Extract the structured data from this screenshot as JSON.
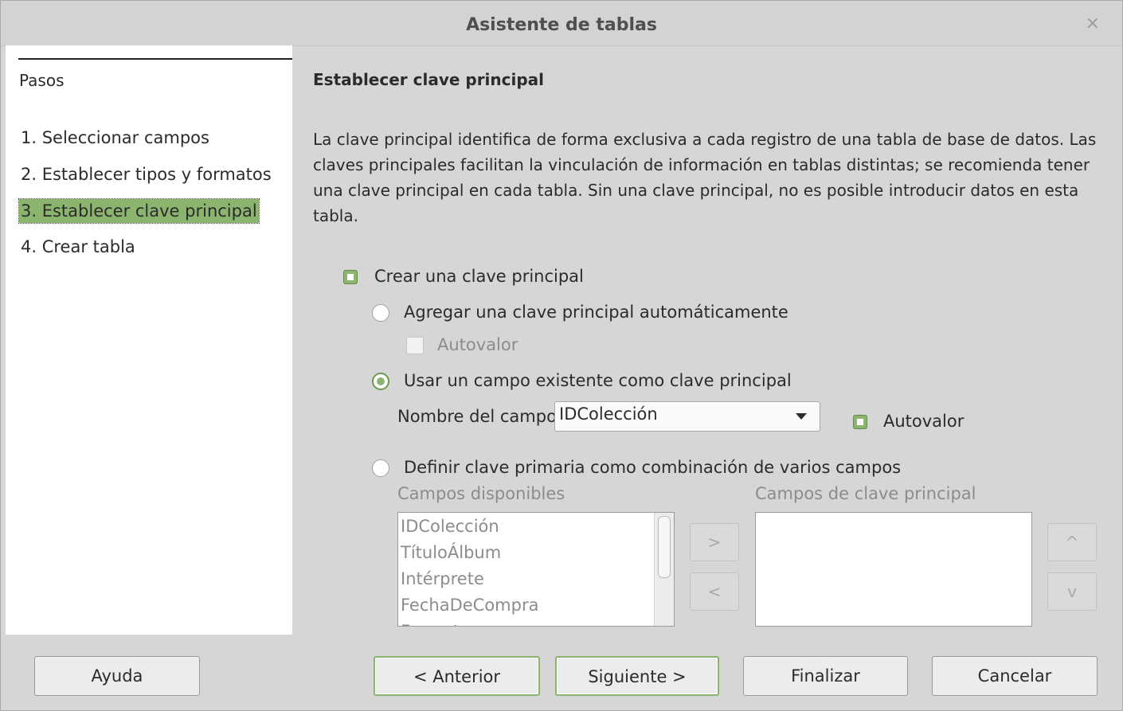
{
  "window": {
    "title": "Asistente de tablas",
    "close_label": "×"
  },
  "sidebar": {
    "heading": "Pasos",
    "steps": [
      "1. Seleccionar campos",
      "2. Establecer tipos y formatos",
      "3. Establecer clave principal",
      "4. Crear tabla"
    ],
    "active_step_index": 2
  },
  "main": {
    "heading": "Establecer clave principal",
    "description": "La clave principal identifica de forma exclusiva a cada registro de una tabla de base de datos. Las claves principales facilitan la vinculación de información en tablas distintas; se recomienda tener una clave principal en cada tabla. Sin una clave principal, no es posible introducir datos en esta tabla.",
    "create_pk": {
      "label": "Crear una clave principal",
      "checked": true
    },
    "auto_pk": {
      "label": "Agregar una clave principal automáticamente",
      "selected": false
    },
    "auto_pk_autovalue": {
      "label": "Autovalor",
      "checked": false,
      "enabled": false
    },
    "existing_field": {
      "label": "Usar un campo existente como clave principal",
      "selected": true
    },
    "field_name": {
      "label": "Nombre del campo",
      "value": "IDColección"
    },
    "existing_autovalue": {
      "label": "Autovalor",
      "checked": true
    },
    "combination": {
      "label": "Definir clave primaria como combinación de varios campos",
      "selected": false
    },
    "available_fields": {
      "label": "Campos disponibles",
      "items": [
        "IDColección",
        "TítuloÁlbum",
        "Intérprete",
        "FechaDeCompra",
        "Formato"
      ]
    },
    "pk_fields": {
      "label": "Campos de clave principal",
      "items": []
    },
    "move_right": ">",
    "move_left": "<",
    "move_up": "^",
    "move_down": "v"
  },
  "buttons": {
    "help": "Ayuda",
    "back": "< Anterior",
    "next": "Siguiente >",
    "finish": "Finalizar",
    "cancel": "Cancelar"
  },
  "colors": {
    "accent": "#8bb56f",
    "background": "#d6d6d6"
  }
}
